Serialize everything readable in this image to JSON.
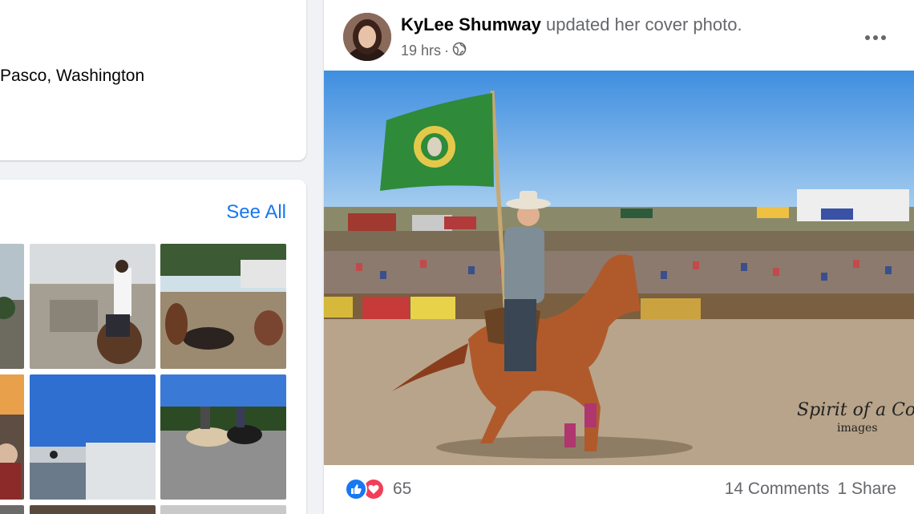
{
  "intro": {
    "location": "Pasco, Washington"
  },
  "photos": {
    "see_all_label": "See All"
  },
  "post": {
    "author": "KyLee Shumway",
    "action": "updated her cover photo.",
    "time": "19 hrs",
    "separator": "·",
    "privacy_icon": "globe-icon",
    "more_icon": "more-options-icon",
    "photo_watermark_line1": "Spirit of a Cowboy",
    "photo_watermark_line2": "images",
    "reaction_count": "65",
    "comments": "14 Comments",
    "shares": "1 Share"
  },
  "colors": {
    "accent": "#1877f2",
    "secondary_text": "#65676b",
    "love": "#f33e58",
    "background": "#f0f2f5"
  }
}
